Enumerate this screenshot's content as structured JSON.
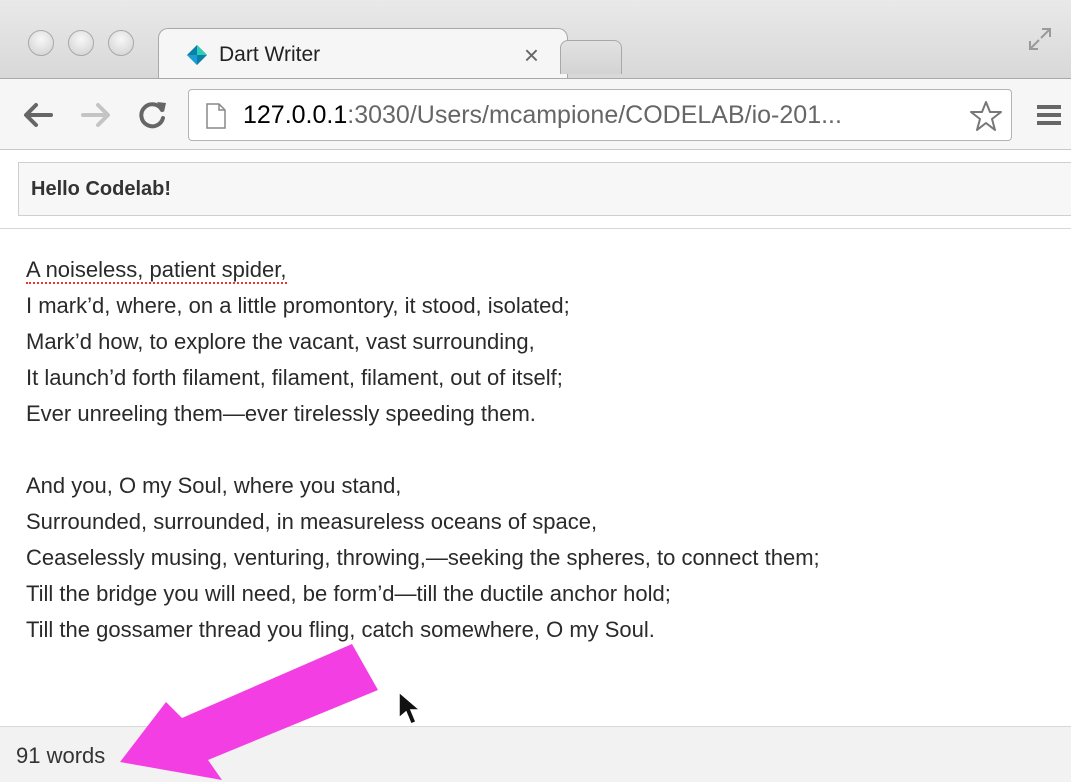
{
  "browser": {
    "tab_title": "Dart Writer",
    "tab_close": "×",
    "url_host": "127.0.0.1",
    "url_rest": ":3030/Users/mcampione/CODELAB/io-201..."
  },
  "page": {
    "header": "Hello Codelab!",
    "stanza1": [
      "A noiseless, patient spider,",
      "I mark’d, where, on a little promontory, it stood, isolated;",
      "Mark’d how, to explore the vacant, vast surrounding,",
      "It launch’d forth filament, filament, filament, out of itself;",
      "Ever unreeling them—ever tirelessly speeding them."
    ],
    "stanza2": [
      "And you, O my Soul, where you stand,",
      "Surrounded, surrounded, in measureless oceans of space,",
      "Ceaselessly musing, venturing, throwing,—seeking the spheres, to connect them;",
      "Till the bridge you will need, be form’d—till the ductile anchor hold;",
      "Till the gossamer thread you fling, catch somewhere, O my Soul."
    ],
    "word_count": "91 words"
  },
  "colors": {
    "arrow": "#f33ee3",
    "spellcheck": "#e33333",
    "dart_logo_a": "#0b7fab",
    "dart_logo_b": "#2dcfb4"
  },
  "icons": [
    "back-arrow-icon",
    "forward-arrow-icon",
    "reload-icon",
    "page-icon",
    "star-icon",
    "menu-icon",
    "fullscreen-icon",
    "dart-logo-icon",
    "mouse-cursor-icon"
  ]
}
